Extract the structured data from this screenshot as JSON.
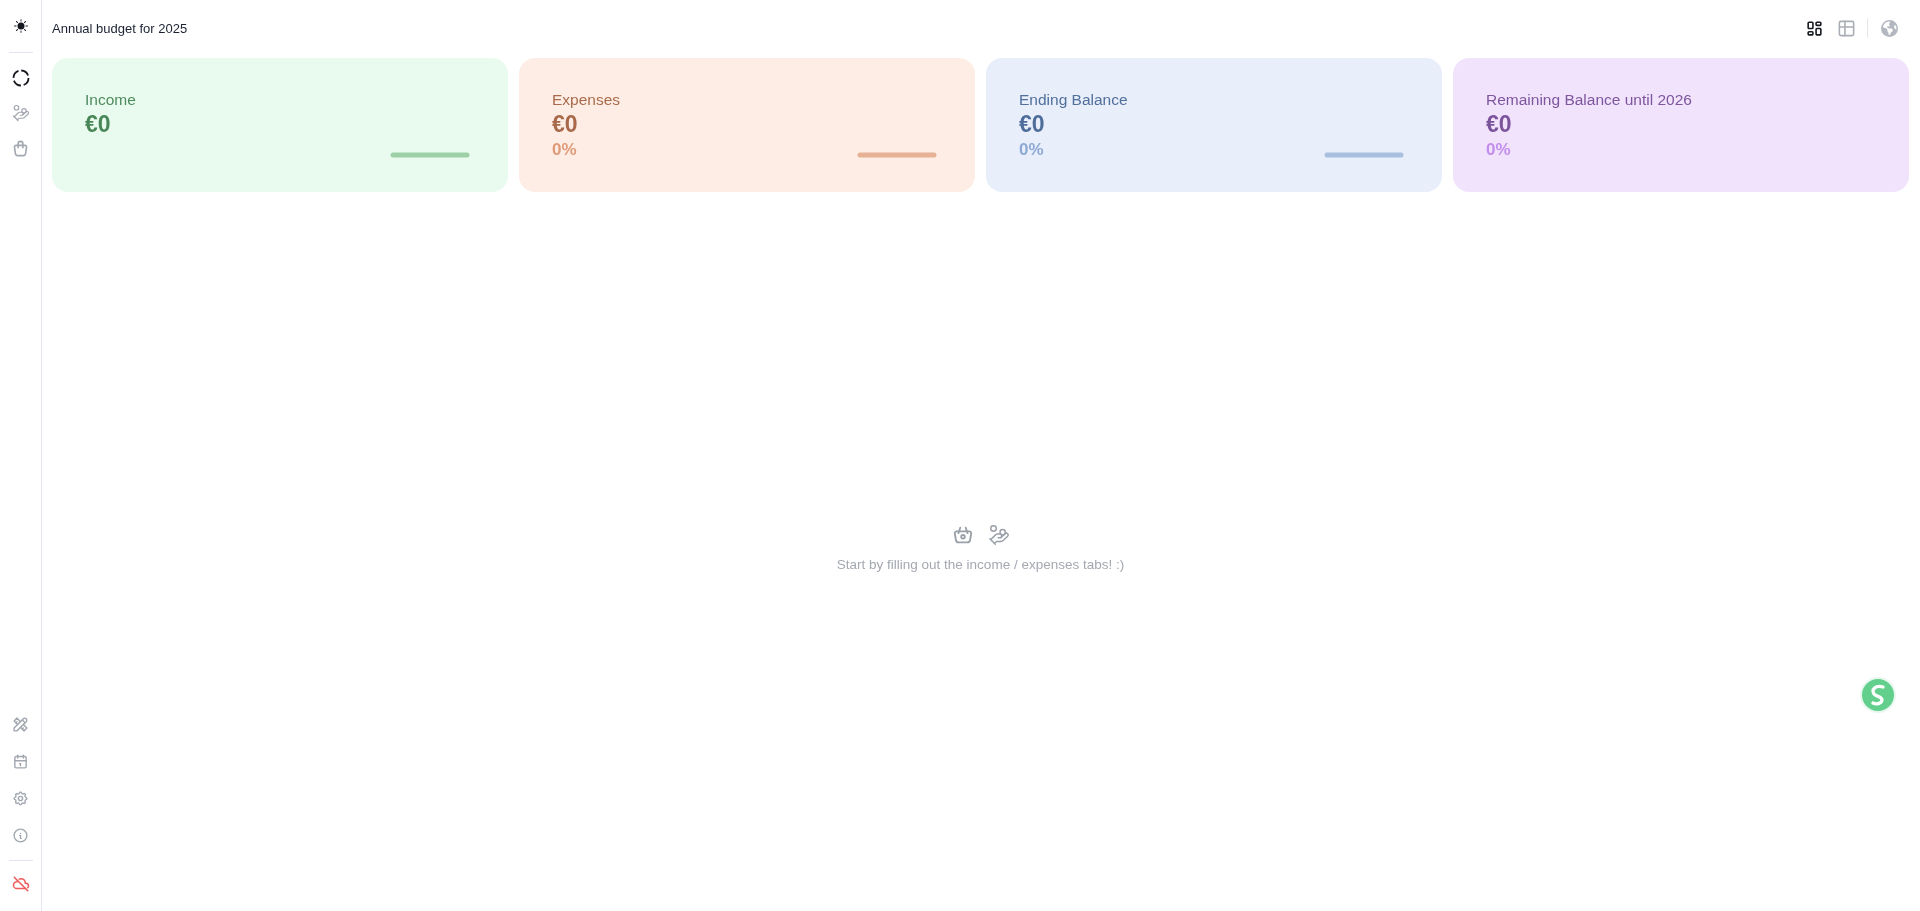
{
  "sidebar": {
    "nav": [
      {
        "kind": "overview",
        "selected": true
      },
      {
        "kind": "income",
        "selected": false
      },
      {
        "kind": "expenses",
        "selected": false
      }
    ],
    "tools": [
      {
        "kind": "tools"
      },
      {
        "kind": "calendar"
      },
      {
        "kind": "settings"
      },
      {
        "kind": "info"
      }
    ],
    "sync": {
      "connected": false
    }
  },
  "header": {
    "title": "Annual budget for 2025",
    "views": [
      {
        "kind": "cards",
        "selected": true
      },
      {
        "kind": "table",
        "selected": false
      }
    ]
  },
  "cards": [
    {
      "kind": "income",
      "label": "Income",
      "amount": "€0",
      "trend_line": true
    },
    {
      "kind": "expenses",
      "label": "Expenses",
      "amount": "€0",
      "percent": "0%",
      "trend_line": true
    },
    {
      "kind": "balance",
      "label": "Ending Balance",
      "amount": "€0",
      "percent": "0%",
      "trend_line": true
    },
    {
      "kind": "remaining",
      "label": "Remaining Balance until 2026",
      "amount": "€0",
      "percent": "0%",
      "trend_line": false
    }
  ],
  "empty_state": {
    "message": "Start by filling out the income / expenses tabs! :)"
  }
}
